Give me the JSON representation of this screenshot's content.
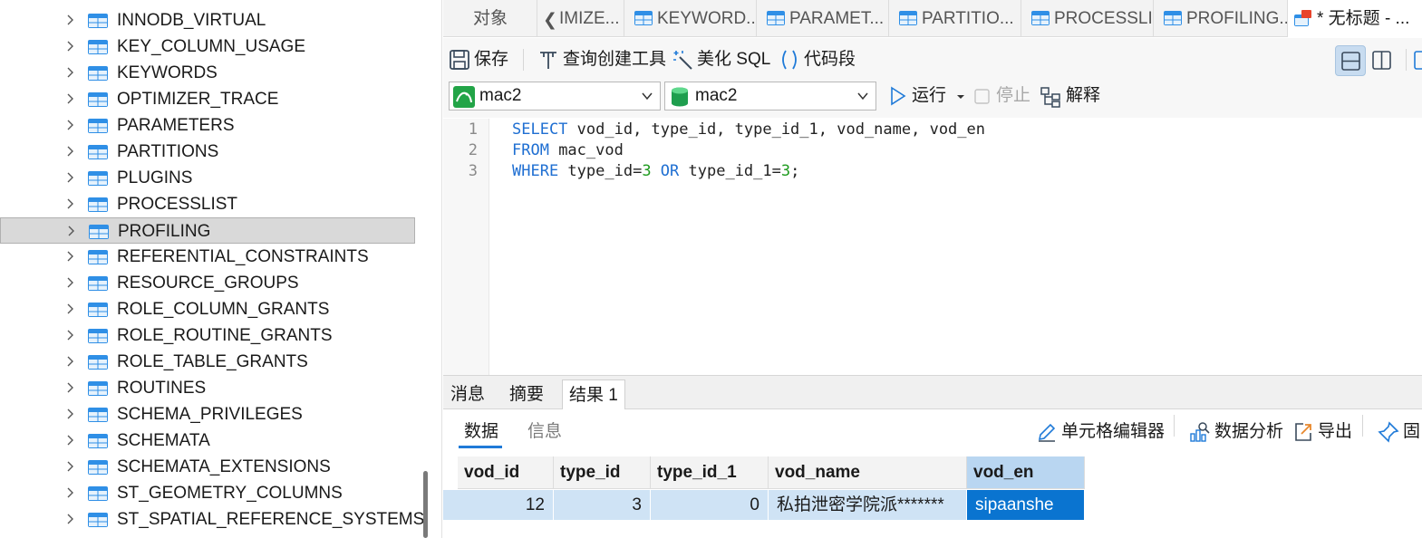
{
  "tree": {
    "items": [
      {
        "label": "INNODB_VIRTUAL"
      },
      {
        "label": "KEY_COLUMN_USAGE"
      },
      {
        "label": "KEYWORDS"
      },
      {
        "label": "OPTIMIZER_TRACE"
      },
      {
        "label": "PARAMETERS"
      },
      {
        "label": "PARTITIONS"
      },
      {
        "label": "PLUGINS"
      },
      {
        "label": "PROCESSLIST"
      },
      {
        "label": "PROFILING",
        "selected": true
      },
      {
        "label": "REFERENTIAL_CONSTRAINTS"
      },
      {
        "label": "RESOURCE_GROUPS"
      },
      {
        "label": "ROLE_COLUMN_GRANTS"
      },
      {
        "label": "ROLE_ROUTINE_GRANTS"
      },
      {
        "label": "ROLE_TABLE_GRANTS"
      },
      {
        "label": "ROUTINES"
      },
      {
        "label": "SCHEMA_PRIVILEGES"
      },
      {
        "label": "SCHEMATA"
      },
      {
        "label": "SCHEMATA_EXTENSIONS"
      },
      {
        "label": "ST_GEOMETRY_COLUMNS"
      },
      {
        "label": "ST_SPATIAL_REFERENCE_SYSTEMS"
      }
    ]
  },
  "tabs": {
    "objects": "对象",
    "t1": "IMIZE...",
    "t2": "KEYWORD...",
    "t3": "PARAMET...",
    "t4": "PARTITIO...",
    "t5": "PROCESSLI...",
    "t6": "PROFILING...",
    "t7": "* 无标题 - ..."
  },
  "toolbar": {
    "save": "保存",
    "query_builder": "查询创建工具",
    "beautify": "美化 SQL",
    "snippet": "代码段"
  },
  "connection": {
    "connection_name": "mac2",
    "database_name": "mac2",
    "run": "运行",
    "stop": "停止",
    "explain": "解释"
  },
  "editor": {
    "line_numbers": [
      "1",
      "2",
      "3"
    ],
    "line1": {
      "kw": "SELECT",
      "rest": " vod_id, type_id, type_id_1, vod_name, vod_en"
    },
    "line2": {
      "kw": "FROM",
      "rest": " mac_vod"
    },
    "line3": {
      "kw1": "WHERE",
      "a": " type_id=",
      "n1": "3",
      "kw2": " OR",
      "b": " type_id_1=",
      "n2": "3",
      "end": ";"
    }
  },
  "result_tabs": {
    "messages": "消息",
    "summary": "摘要",
    "result1": "结果 1"
  },
  "result_toolbar": {
    "data": "数据",
    "info": "信息",
    "cell_editor": "单元格编辑器",
    "data_analysis": "数据分析",
    "export": "导出",
    "pin": "固"
  },
  "grid": {
    "columns": [
      "vod_id",
      "type_id",
      "type_id_1",
      "vod_name",
      "vod_en"
    ],
    "rows": [
      [
        "12",
        "3",
        "0",
        "私拍泄密学院派*******",
        "sipaanshe"
      ]
    ]
  },
  "colors": {
    "accent": "#1f7ad8",
    "selected_cell": "#0a74d0",
    "row_highlight": "#cfe3f5",
    "keyword": "#1f6fd2",
    "number": "#1f9b1f"
  }
}
